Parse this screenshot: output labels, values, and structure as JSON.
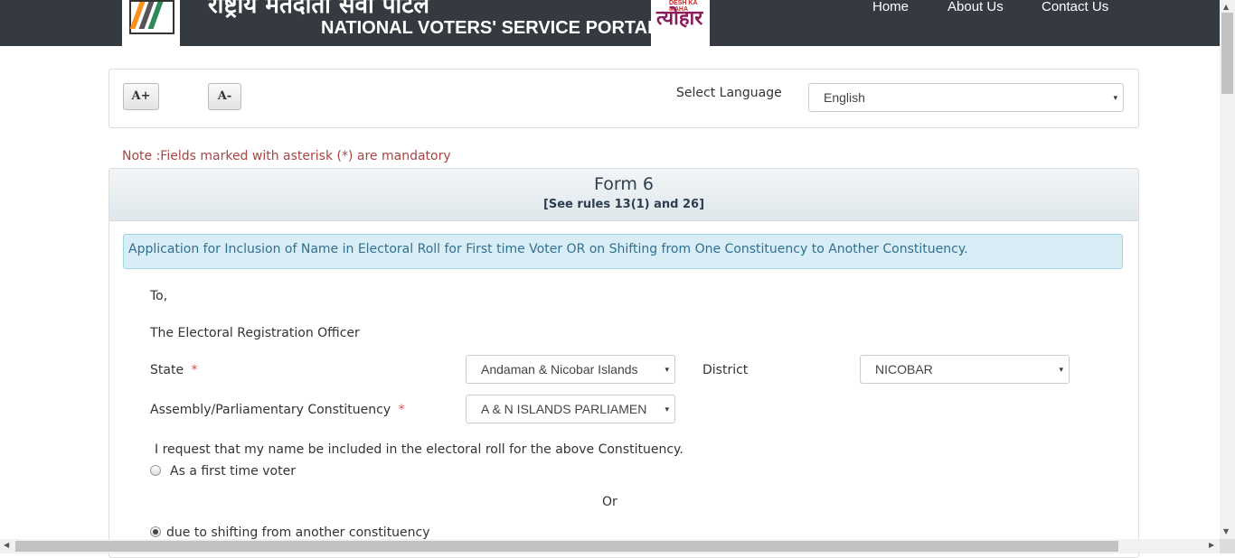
{
  "header": {
    "hindi_title": "राष्ट्रीय मतदाता सेवा पोर्टल",
    "english_title": "NATIONAL VOTERS' SERVICE PORTAL",
    "right_logo_small": "DESH KA MAHA",
    "right_logo_big": "त्योहार",
    "nav": [
      "Home",
      "About Us",
      "Contact Us"
    ]
  },
  "toolbar": {
    "increase_font": "A+",
    "decrease_font": "A-",
    "language_label": "Select Language",
    "language_value": "English"
  },
  "note": "Note :Fields marked with asterisk (*) are mandatory",
  "form": {
    "title": "Form 6",
    "subtitle": "[See rules 13(1) and 26]",
    "info": "Application for Inclusion of Name in Electoral Roll for First time Voter OR on Shifting from One Constituency to Another Constituency.",
    "to": "To,",
    "officer": "The Electoral Registration Officer",
    "state_label": "State",
    "state_value": "Andaman & Nicobar Islands",
    "district_label": "District",
    "district_value": "NICOBAR",
    "constituency_label": "Assembly/Parliamentary Constituency",
    "constituency_value": "A & N ISLANDS PARLIAMEN",
    "required_mark": "*",
    "request_text": "I request that my name be included in the electoral roll for the above Constituency.",
    "option_first_time": "As a first time voter",
    "or_text": "Or",
    "option_shifting": "due to shifting from another constituency",
    "selected_option": "due to shifting from another constituency"
  },
  "icons": {
    "dropdown": "▾",
    "scroll_up": "▲",
    "scroll_down": "▼",
    "scroll_left": "◀",
    "scroll_right": "▶"
  },
  "colors": {
    "header_bg": "#343a40",
    "note_text": "#a94442",
    "info_bg": "#d9edf7",
    "required": "#d9534f"
  }
}
